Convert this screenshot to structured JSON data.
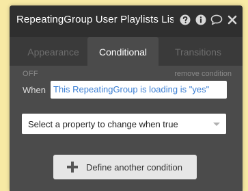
{
  "window": {
    "title": "RepeatingGroup User Playlists Lis",
    "icons": [
      "help-icon",
      "info-icon",
      "comment-icon",
      "close-icon"
    ]
  },
  "tabs": [
    {
      "label": "Appearance",
      "active": false
    },
    {
      "label": "Conditional",
      "active": true
    },
    {
      "label": "Transitions",
      "active": false
    }
  ],
  "condition": {
    "status": "OFF",
    "remove_label": "remove condition",
    "when_label": "When",
    "expression": "This RepeatingGroup is loading is \"yes\""
  },
  "property_select": {
    "placeholder": "Select a property to change when true"
  },
  "define_button": {
    "label": "Define another condition"
  },
  "colors": {
    "background": "#f7e9a4",
    "titlebar": "#2f2f2f",
    "panel": "#4b4b4b",
    "expression_text": "#3b7fd4"
  }
}
